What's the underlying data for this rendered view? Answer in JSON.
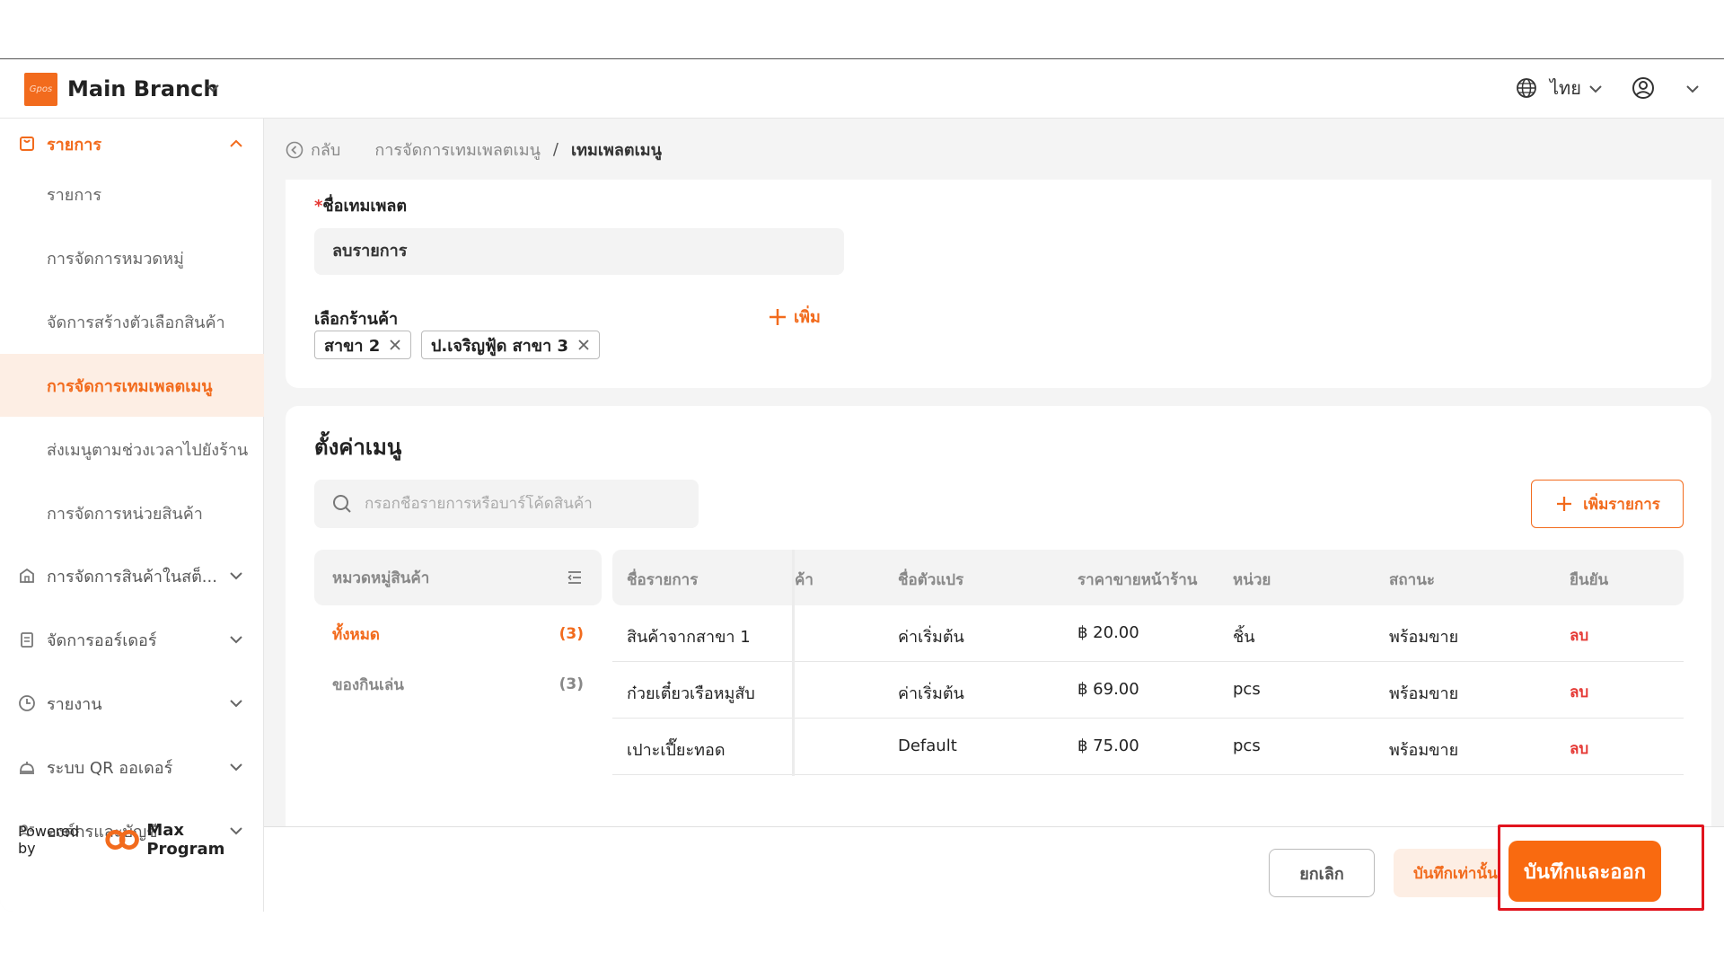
{
  "header": {
    "logo_text": "Gpos",
    "branch_name": "Main Branch",
    "language": "ไทย"
  },
  "sidebar": {
    "groups": [
      {
        "label": "รายการ",
        "icon": "bag-icon",
        "expanded": true
      },
      {
        "label": "การจัดการสินค้าในสต็...",
        "icon": "store-icon"
      },
      {
        "label": "จัดการออร์เดอร์",
        "icon": "clipboard-icon"
      },
      {
        "label": "รายงาน",
        "icon": "clock-icon"
      },
      {
        "label": "ระบบ QR ออเดอร์",
        "icon": "bell-icon"
      },
      {
        "label": "องค์กรและบัญชี",
        "icon": "users-icon"
      }
    ],
    "sub_items": [
      {
        "label": "รายการ"
      },
      {
        "label": "การจัดการหมวดหมู่"
      },
      {
        "label": "จัดการสร้างตัวเลือกสินค้า"
      },
      {
        "label": "การจัดการเทมเพลตเมนู",
        "active": true
      },
      {
        "label": "ส่งเมนูตามช่วงเวลาไปยังร้าน"
      },
      {
        "label": "การจัดการหน่วยสินค้า"
      }
    ],
    "powered_by": "Powered by",
    "powered_brand": "Max Program"
  },
  "breadcrumb": {
    "back": "กลับ",
    "parent": "การจัดการเทมเพลตเมนู",
    "separator": "/",
    "current": "เทมเพลตเมนู"
  },
  "template_form": {
    "name_label": "ชื่อเทมเพลต",
    "name_required_mark": "*",
    "name_value": "ลบรายการ",
    "store_label": "เลือกร้านค้า",
    "add_label": "เพิ่ม",
    "stores": [
      "สาขา 2",
      "ป.เจริญฟู้ด สาขา 3"
    ]
  },
  "menu_settings": {
    "title": "ตั้งค่าเมนู",
    "search_placeholder": "กรอกชื่อรายการหรือบาร์โค้ดสินค้า",
    "add_item_label": "เพิ่มรายการ",
    "category_header": "หมวดหมู่สินค้า",
    "categories": [
      {
        "name": "ทั้งหมด",
        "count": "(3)",
        "active": true
      },
      {
        "name": "ของกินเล่น",
        "count": "(3)"
      }
    ],
    "columns": [
      "ชื่อรายการ",
      "ค้า",
      "ชื่อตัวแปร",
      "ราคาขายหน้าร้าน",
      "หน่วย",
      "สถานะ",
      "ยืนยัน"
    ],
    "rows": [
      {
        "name": "สินค้าจากสาขา 1",
        "variant": "ค่าเริ่มต้น",
        "price": "฿ 20.00",
        "unit": "ชิ้น",
        "status": "พร้อมขาย",
        "action": "ลบ"
      },
      {
        "name": "ก๋วยเตี๋ยวเรือหมูสับ",
        "variant": "ค่าเริ่มต้น",
        "price": "฿ 69.00",
        "unit": "pcs",
        "status": "พร้อมขาย",
        "action": "ลบ"
      },
      {
        "name": "เปาะเปี๊ยะทอด",
        "variant": "Default",
        "price": "฿ 75.00",
        "unit": "pcs",
        "status": "พร้อมขาย",
        "action": "ลบ"
      }
    ]
  },
  "footer": {
    "cancel": "ยกเลิก",
    "save_only": "บันทึกเท่านั้น",
    "save_exit": "บันทึกและออก"
  },
  "colors": {
    "accent": "#f26b1d",
    "danger": "#e53935",
    "highlight": "#e1141e"
  }
}
